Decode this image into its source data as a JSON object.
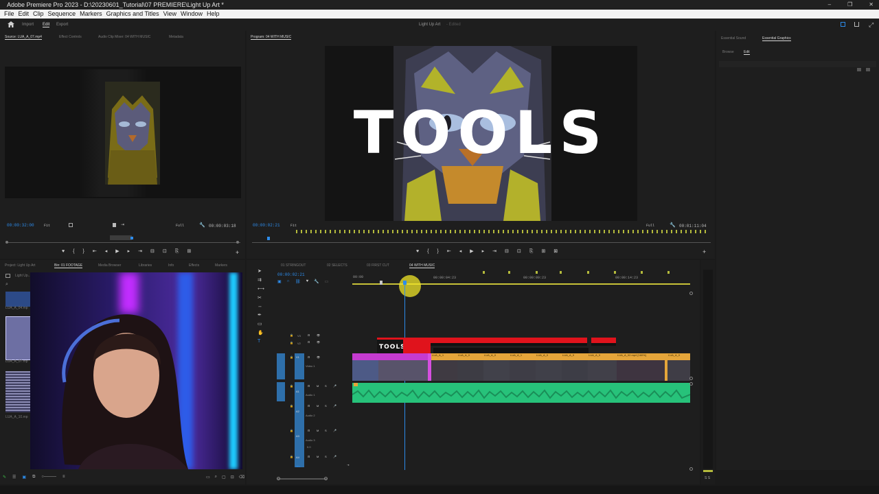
{
  "app": {
    "title": "Adobe Premiere Pro 2023 - D:\\20230601_Tutorial\\07 PREMIERE\\Light Up Art *",
    "window_controls": [
      "–",
      "❐",
      "✕"
    ]
  },
  "menu": [
    "File",
    "Edit",
    "Clip",
    "Sequence",
    "Markers",
    "Graphics and Titles",
    "View",
    "Window",
    "Help"
  ],
  "workspace": {
    "tabs": [
      "Import",
      "Edit",
      "Export"
    ],
    "active_tab": "Edit",
    "project_name": "Light Up Art",
    "project_state": "- Edited"
  },
  "source_monitor": {
    "tabs": [
      "Source: LUA_A_07.mp4",
      "Effect Controls",
      "Audio Clip Mixer: 04 WITH MUSIC",
      "Metadata"
    ],
    "timecode": "00:00:32:00",
    "fit": "Fit",
    "quality": "Full",
    "duration": "00:00:03:18"
  },
  "program_monitor": {
    "tab": "Program: 04 WITH MUSIC",
    "overlay_title": "TOOLS",
    "timecode": "00:00:02:21",
    "fit": "Fit",
    "quality": "Full",
    "duration": "00:01:11:04"
  },
  "right_panel": {
    "tabs": [
      "Essential Sound",
      "Essential Graphics"
    ],
    "subtabs": [
      "Browse",
      "Edit"
    ],
    "active_subtab": "Edit"
  },
  "project_panel": {
    "tabs": [
      "Project: Light Up Art",
      "Bin: 01 FOOTAGE",
      "Media Browser",
      "Libraries",
      "Info",
      "Effects",
      "Markers"
    ],
    "breadcrumb": "Light Up...",
    "items": [
      "LUA_A_04.mp",
      "LUA_A_07.mp",
      "LUA_A_10.mp"
    ]
  },
  "timeline": {
    "sequence_tabs": [
      "01 STRINGOUT",
      "02 SELECTS",
      "03 FIRST CUT",
      "04 WITH MUSIC"
    ],
    "active_tab": "04 WITH MUSIC",
    "timecode": "00:00:02:21",
    "ruler": [
      "00:00",
      "00:00:04:23",
      "00:00:09:23",
      "00:00:14:23"
    ],
    "video_tracks": [
      {
        "id": "V3",
        "name": ""
      },
      {
        "id": "V2",
        "name": ""
      },
      {
        "id": "V1",
        "name": "Video 1"
      }
    ],
    "audio_tracks": [
      {
        "id": "A1",
        "name": "Audio 1"
      },
      {
        "id": "A2",
        "name": "Audio 2"
      },
      {
        "id": "A3",
        "name": "Audio 3"
      },
      {
        "id": "A4",
        "name": ""
      }
    ],
    "mix_label": "Mix",
    "mix_value": "0.0",
    "title_clip": "TOOLS",
    "clips_v1": [
      "LUA_A_1",
      "LUA_A_0",
      "LUA_A_0",
      "LUA_A_1",
      "LUA_A_0",
      "LUA_A_0",
      "LUA_A_0",
      "LUA_A_0",
      "LUA_A_02.mp4 [160%]"
    ],
    "audio_meter": "S S"
  },
  "colors": {
    "accent_blue": "#2d8ceb",
    "video_clip": "#e5a53a",
    "title_clip": "#e0131c",
    "audio_clip": "#27c27a",
    "magenta_clip": "#c53bd0"
  }
}
